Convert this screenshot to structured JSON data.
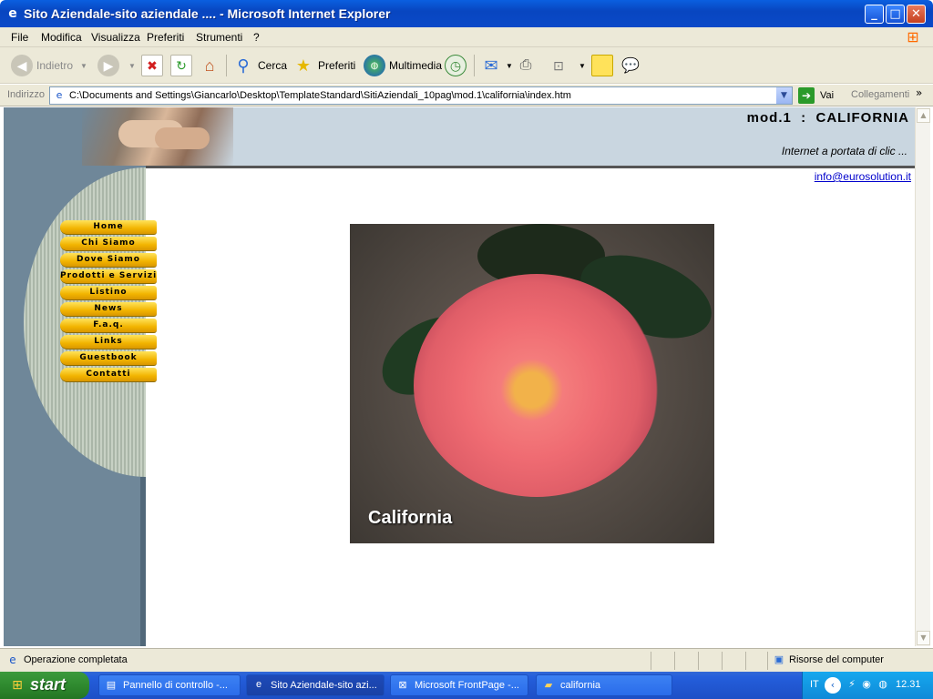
{
  "window": {
    "title": "Sito Aziendale-sito aziendale .... - Microsoft Internet Explorer",
    "controls": {
      "minimize": "_",
      "maximize": "□",
      "close": "✕"
    }
  },
  "menu": [
    "File",
    "Modifica",
    "Visualizza",
    "Preferiti",
    "Strumenti",
    "?"
  ],
  "toolbar": {
    "back": "Indietro",
    "search": "Cerca",
    "favorites": "Preferiti",
    "media": "Multimedia"
  },
  "address": {
    "label": "Indirizzo",
    "url": "C:\\Documents and Settings\\Giancarlo\\Desktop\\TemplateStandard\\SitiAziendali_10pag\\mod.1\\california\\index.htm",
    "go": "Vai",
    "links": "Collegamenti"
  },
  "page": {
    "header_title": "mod.1  :  CALIFORNIA",
    "header_subtitle": "Internet a portata di clic ...",
    "email": "info@eurosolution.it",
    "nav": [
      "Home",
      "Chi Siamo",
      "Dove Siamo",
      "Prodotti e Servizi",
      "Listino",
      "News",
      "F.a.q.",
      "Links",
      "Guestbook",
      "Contatti"
    ],
    "photo_caption": "California"
  },
  "status": {
    "text": "Operazione completata",
    "zone": "Risorse del computer"
  },
  "taskbar": {
    "start": "start",
    "tasks": [
      "Pannello di controllo -...",
      "Sito Aziendale-sito azi...",
      "Microsoft FrontPage -...",
      "california"
    ],
    "lang": "IT",
    "clock": "12.31"
  },
  "colors": {
    "title_bar": "#0846c0",
    "nav_button": "#f2b400",
    "header_band": "#c9d6e0",
    "left_column": "#6f8799",
    "link": "#0000cc"
  }
}
